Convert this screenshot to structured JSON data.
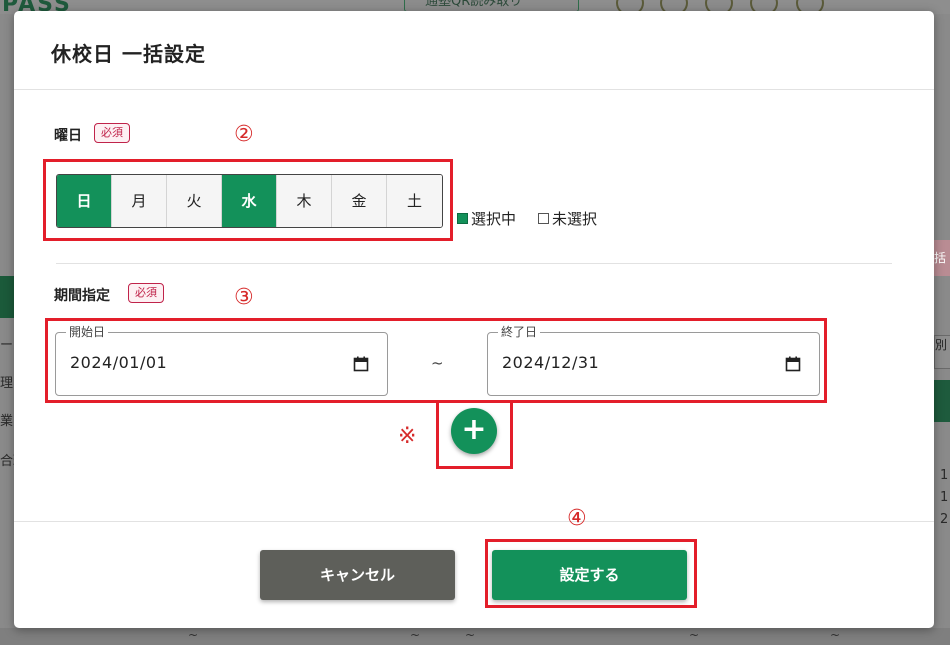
{
  "background": {
    "logo": "PASS",
    "qr_button": "通塾QR読み取り",
    "left_texts": [
      "ール",
      "理",
      "業",
      "合理"
    ],
    "right_texts": [
      "括",
      "別",
      "1",
      "1",
      "2"
    ],
    "tildes": [
      "~",
      "~",
      "~",
      "~",
      "~"
    ]
  },
  "modal": {
    "title": "休校日 一括設定",
    "weekday": {
      "label": "曜日",
      "required": "必須",
      "marker": "②",
      "days": [
        {
          "label": "日",
          "selected": true
        },
        {
          "label": "月",
          "selected": false
        },
        {
          "label": "火",
          "selected": false
        },
        {
          "label": "水",
          "selected": true
        },
        {
          "label": "木",
          "selected": false
        },
        {
          "label": "金",
          "selected": false
        },
        {
          "label": "土",
          "selected": false
        }
      ],
      "legend_selected": "選択中",
      "legend_unselected": "未選択"
    },
    "period": {
      "label": "期間指定",
      "required": "必須",
      "marker": "③",
      "start_label": "開始日",
      "start_value": "2024/01/01",
      "separator": "~",
      "end_label": "終了日",
      "end_value": "2024/12/31",
      "add_marker": "※",
      "add_label": "+"
    },
    "footer": {
      "marker": "④",
      "cancel_label": "キャンセル",
      "submit_label": "設定する"
    }
  },
  "colors": {
    "accent": "#13915a",
    "highlight": "#e31e2a",
    "required": "#c0234a",
    "cancel": "#5e5f5a"
  }
}
